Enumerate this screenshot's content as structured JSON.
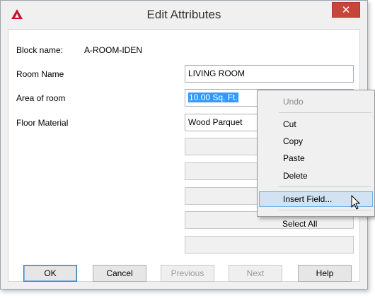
{
  "window": {
    "title": "Edit Attributes",
    "close_glyph": "✕"
  },
  "block": {
    "label": "Block name:",
    "value": "A-ROOM-IDEN"
  },
  "attributes": [
    {
      "label": "Room Name",
      "value": "LIVING ROOM"
    },
    {
      "label": "Area of room",
      "value": "10.00 Sq. Ft."
    },
    {
      "label": "Floor Material",
      "value": "Wood Parquet"
    }
  ],
  "buttons": {
    "ok": "OK",
    "cancel": "Cancel",
    "previous": "Previous",
    "next": "Next",
    "help": "Help"
  },
  "context_menu": {
    "items": [
      "Undo",
      "Cut",
      "Copy",
      "Paste",
      "Delete",
      "Insert Field...",
      "Select All"
    ],
    "disabled": [
      "Undo"
    ],
    "highlighted": "Insert Field..."
  },
  "colors": {
    "app_icon": "#c8102e",
    "close_button": "#c7463a",
    "selection": "#3399ff",
    "menu_hover": "#d1e2f2"
  },
  "icons": {
    "app": "autocad-icon",
    "cursor": "arrow-cursor-icon"
  }
}
